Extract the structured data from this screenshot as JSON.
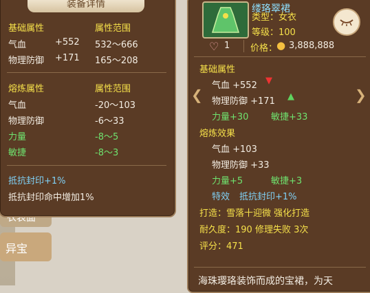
{
  "left": {
    "title": "装备详情",
    "base_header": "基础属性",
    "range_header": "属性范围",
    "base_rows": [
      {
        "name": "气血",
        "value": "+552",
        "range": "532～666"
      },
      {
        "name": "物理防御",
        "value": "+171",
        "range": "165～208"
      }
    ],
    "refine_header": "熔炼属性",
    "refine_range_header": "属性范围",
    "refine_rows": [
      {
        "name": "气血",
        "range": "-20～103"
      },
      {
        "name": "物理防御",
        "range": "-6～33"
      },
      {
        "name": "力量",
        "range": "-8～5"
      },
      {
        "name": "敏捷",
        "range": "-8～3"
      }
    ],
    "effect1": "抵抗封印+1%",
    "effect2": "抵抗封印命中增加1%"
  },
  "bg": {
    "tab1": "衣表面",
    "tab2": "异宝"
  },
  "right": {
    "item_name": "缕珞翠裙",
    "type_text": "类型：女衣",
    "level_text": "等级：100",
    "likes": "1",
    "price_label": "价格：",
    "price_value": "3,888,888",
    "base_header": "基础属性",
    "hp": "气血  +552",
    "def": "物理防御  +171",
    "str": "力量+30",
    "agi": "敏捷+33",
    "refine_header": "熔炼效果",
    "r_hp": "气血  +103",
    "r_def": "物理防御  +33",
    "r_str": "力量+5",
    "r_agi": "敏捷+3",
    "special_label": "特效",
    "special_value": "抵抗封印+1%",
    "forge": "打造：雪落十迎微   强化打造",
    "durability": "耐久度：190  修理失败 3次",
    "score": "评分：471",
    "desc": "海珠璎珞装饰而成的宝裙，为天"
  },
  "colors": {
    "panel": "#5a3b25",
    "yellow": "#f5e04a",
    "green": "#6fe36f",
    "cyan": "#7fd0f5"
  }
}
